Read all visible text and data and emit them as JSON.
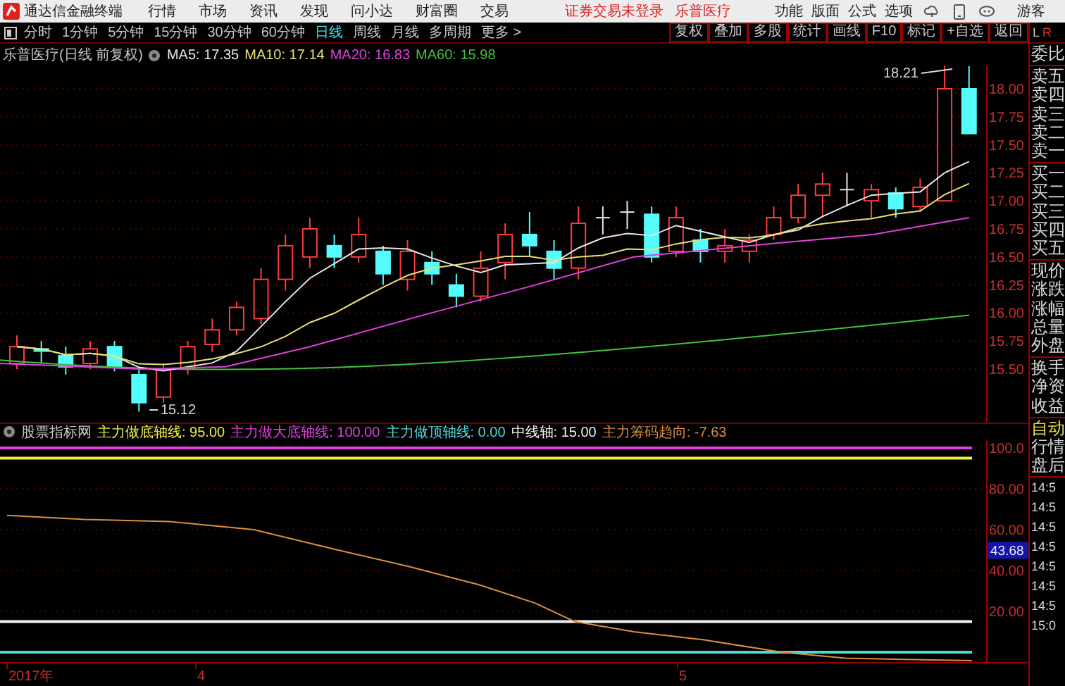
{
  "title_bar": {
    "app_name": "通达信金融终端",
    "menus": [
      "行情",
      "市场",
      "资讯",
      "发现",
      "问小达",
      "财富圈",
      "交易"
    ],
    "notices": [
      "证券交易未登录",
      "乐普医疗"
    ],
    "right_menus": [
      "功能",
      "版面",
      "公式",
      "选项"
    ],
    "user": "游客"
  },
  "period_bar": {
    "periods": [
      {
        "label": "分时",
        "selected": false
      },
      {
        "label": "1分钟",
        "selected": false
      },
      {
        "label": "5分钟",
        "selected": false
      },
      {
        "label": "15分钟",
        "selected": false
      },
      {
        "label": "30分钟",
        "selected": false
      },
      {
        "label": "60分钟",
        "selected": false
      },
      {
        "label": "日线",
        "selected": true
      },
      {
        "label": "周线",
        "selected": false
      },
      {
        "label": "月线",
        "selected": false
      },
      {
        "label": "多周期",
        "selected": false
      }
    ],
    "more": "更多 >",
    "tools": [
      "复权",
      "叠加",
      "多股",
      "统计",
      "画线",
      "F10",
      "标记",
      "+自选",
      "返回"
    ]
  },
  "chart": {
    "title": "乐普医疗(日线 前复权)",
    "ma": [
      {
        "label": "MA5: 17.35",
        "color": "#e8e8e8"
      },
      {
        "label": "MA10: 17.14",
        "color": "#e8e070"
      },
      {
        "label": "MA20: 16.83",
        "color": "#e040e0"
      },
      {
        "label": "MA60: 15.98",
        "color": "#40c040"
      }
    ],
    "price_ticks": [
      "18.00",
      "17.75",
      "17.50",
      "17.25",
      "17.00",
      "16.75",
      "16.50",
      "16.25",
      "16.00",
      "15.75",
      "15.50"
    ],
    "high_label": "18.21",
    "low_label": "15.12"
  },
  "indicator": {
    "name": "股票指标网",
    "lines": [
      {
        "label": "主力做底轴线: 95.00",
        "color": "#f0f040"
      },
      {
        "label": "主力做大底轴线: 100.00",
        "color": "#e040e0"
      },
      {
        "label": "主力做顶轴线: 0.00",
        "color": "#50d8d8"
      },
      {
        "label": "中线轴: 15.00",
        "color": "#f0f0f0"
      },
      {
        "label": "主力筹码趋向: -7.63",
        "color": "#d89040"
      }
    ],
    "ticks": [
      "100.0",
      "80.00",
      "60.00",
      "40.00",
      "20.00"
    ],
    "current": "43.68"
  },
  "x_axis": [
    "2017年",
    "4",
    "5"
  ],
  "side_panel": {
    "header": [
      "L",
      "R"
    ],
    "sections": [
      [
        "委比"
      ],
      [
        "卖五",
        "卖四",
        "卖三",
        "卖二",
        "卖一"
      ],
      [
        "买一",
        "买二",
        "买三",
        "买四",
        "买五"
      ],
      [
        "现价",
        "涨跌",
        "涨幅",
        "总量",
        "外盘"
      ],
      [
        "换手",
        "净资",
        "收益"
      ]
    ],
    "modes": [
      {
        "label": "自动",
        "selected": true
      },
      {
        "label": "行情",
        "selected": false
      },
      {
        "label": "盘后",
        "selected": false
      }
    ],
    "times": [
      "14:5",
      "14:5",
      "14:5",
      "14:5",
      "14:5",
      "14:5",
      "14:5",
      "15:0"
    ]
  }
}
